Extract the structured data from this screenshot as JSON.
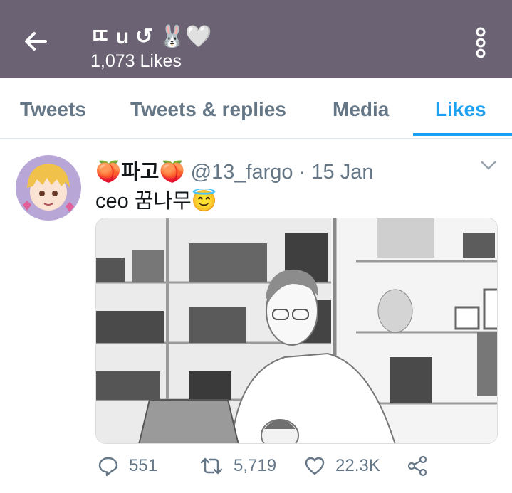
{
  "header": {
    "title": "ㄸ u ↺ 🐰🤍",
    "likes_count": "1,073 Likes",
    "colors": {
      "background": "#6b6374",
      "text": "#ffffff"
    },
    "icons": {
      "back": "arrow-left-icon",
      "menu": "more-vertical-icon"
    }
  },
  "tabs": [
    {
      "label": "Tweets",
      "active": false
    },
    {
      "label": "Tweets & replies",
      "active": false
    },
    {
      "label": "Media",
      "active": false
    },
    {
      "label": "Likes",
      "active": true
    }
  ],
  "accent_color": "#1da1f2",
  "tweet": {
    "display_name": "🍑파고🍑",
    "handle": "@13_fargo",
    "separator": "·",
    "date": "15 Jan",
    "text": "ceo 꿈나무😇",
    "avatar_icon": "avatar-icon",
    "media_icon": "manga-illustration",
    "actions": {
      "replies": "551",
      "retweets": "5,719",
      "likes": "22.3K"
    }
  }
}
